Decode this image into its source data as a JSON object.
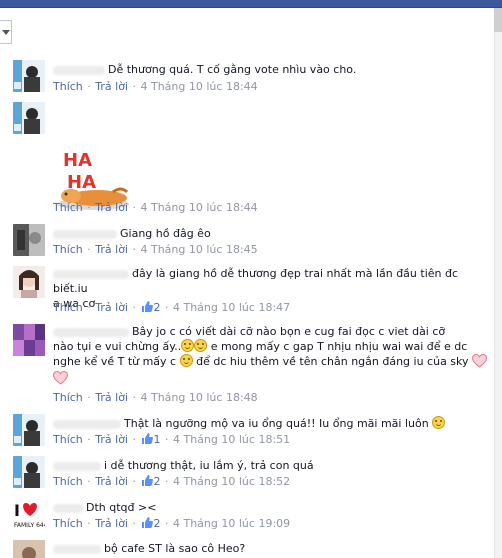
{
  "comments": [
    {
      "id": "c1",
      "text": "Dễ thương quá. T cố gằng vote nhìu vào cho.",
      "actions": {
        "like": "Thích",
        "reply": "Trả lời",
        "time": "4 Tháng 10 lúc 18:44"
      }
    },
    {
      "id": "c2",
      "sticker": "haha-dog-sticker",
      "actions": {
        "like": "Thích",
        "reply": "Trả lời",
        "time": "4 Tháng 10 lúc 18:44"
      }
    },
    {
      "id": "c3",
      "text": "Giang hồ đâg êo",
      "actions": {
        "like": "Thích",
        "reply": "Trả lời",
        "time": "4 Tháng 10 lúc 18:45"
      }
    },
    {
      "id": "c4",
      "text_line1": "đây là giang hồ dễ thương đẹp trai nhất mà lần đầu tiên đc biết.iu",
      "text_line2": "a wa cơ",
      "actions": {
        "like": "Thích",
        "reply": "Trả lời",
        "likes": "2",
        "time": "4 Tháng 10 lúc 18:47"
      }
    },
    {
      "id": "c5",
      "text_line1": "Bây jo c có viết dài cỡ nào bọn e cug fai đọc c viet dài cỡ",
      "text_line2a": "nào tụi e vui chừng ấy..",
      "text_line2b": " e mong mấy c gap T nhịu nhịu wai wai để e dc",
      "text_line3a": "nghe kể về T từ mấy c ",
      "text_line3b": " để dc hiu thêm về tên chân ngắn đáng iu của sky",
      "actions": {
        "like": "Thích",
        "reply": "Trả lời",
        "time": "4 Tháng 10 lúc 18:48"
      }
    },
    {
      "id": "c6",
      "text": "Thật là ngưỡng mộ va iu ổng quá!! Iu ổng mãi mãi luôn",
      "actions": {
        "like": "Thích",
        "reply": "Trả lời",
        "likes": "1",
        "time": "4 Tháng 10 lúc 18:51"
      }
    },
    {
      "id": "c7",
      "text": "i dễ thương thật, iu lắm ý, trả con quá",
      "actions": {
        "like": "Thích",
        "reply": "Trả lời",
        "likes": "2",
        "time": "4 Tháng 10 lúc 18:52"
      }
    },
    {
      "id": "c8",
      "text": "Dth qtqđ ><",
      "actions": {
        "like": "Thích",
        "reply": "Trả lời",
        "likes": "2",
        "time": "4 Tháng 10 lúc 19:09"
      }
    },
    {
      "id": "c9",
      "text": "bộ cafe ST là sao cô Heo?"
    }
  ],
  "colors": {
    "link": "#4e69a2",
    "meta": "#9197a3",
    "brand": "#3b5998"
  }
}
